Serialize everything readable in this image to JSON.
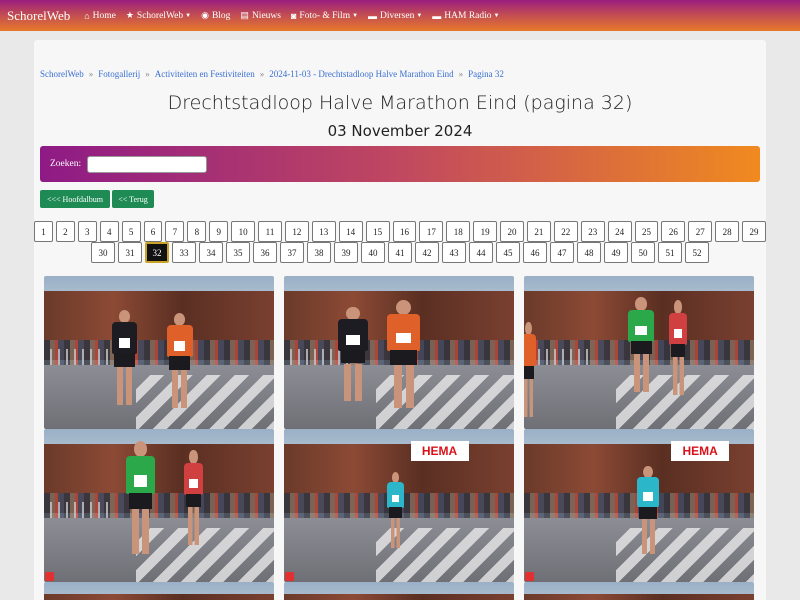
{
  "navbar": {
    "brand": "SchorelWeb",
    "items": [
      {
        "icon": "home-icon",
        "glyph": "⌂",
        "label": "Home",
        "dropdown": false
      },
      {
        "icon": "star-icon",
        "glyph": "★",
        "label": "SchorelWeb",
        "dropdown": true
      },
      {
        "icon": "rss-icon",
        "glyph": "◉",
        "label": "Blog",
        "dropdown": false
      },
      {
        "icon": "newspaper-icon",
        "glyph": "▤",
        "label": "Nieuws",
        "dropdown": false
      },
      {
        "icon": "camera-icon",
        "glyph": "◙",
        "label": "Foto- & Film",
        "dropdown": true
      },
      {
        "icon": "folder-icon",
        "glyph": "▬",
        "label": "Diversen",
        "dropdown": true
      },
      {
        "icon": "folder-icon",
        "glyph": "▬",
        "label": "HAM Radio",
        "dropdown": true
      }
    ]
  },
  "breadcrumb": [
    "SchorelWeb",
    "Fotogallerij",
    "Activiteiten en Festiviteiten",
    "2024-11-03 - Drechtstadloop Halve Marathon Eind",
    "Pagina 32"
  ],
  "page": {
    "title": "Drechtstadloop Halve Marathon Eind (pagina 32)",
    "date": "03 November 2024"
  },
  "search": {
    "label": "Zoeken:",
    "value": "",
    "placeholder": ""
  },
  "buttons": {
    "main_album": "<<< Hoofdalbum",
    "back": "<< Terug"
  },
  "pagination": {
    "current": "32",
    "row1": [
      "1",
      "2",
      "3",
      "4",
      "5",
      "6",
      "7",
      "8",
      "9",
      "10",
      "11",
      "12",
      "13",
      "14",
      "15",
      "16",
      "17",
      "18",
      "19",
      "20",
      "21",
      "22",
      "23",
      "24",
      "25",
      "26",
      "27",
      "28",
      "29"
    ],
    "row2": [
      "30",
      "31",
      "32",
      "33",
      "34",
      "35",
      "36",
      "37",
      "38",
      "39",
      "40",
      "41",
      "42",
      "43",
      "44",
      "45",
      "46",
      "47",
      "48",
      "49",
      "50",
      "51",
      "52"
    ]
  },
  "photo_signs": {
    "store": "HEMA"
  },
  "colors": {
    "navbar_start": "#9a1e7e",
    "navbar_end": "#e8792a",
    "button_green": "#1e8b55",
    "active_page_border": "#c9a227",
    "link": "#3a6fd0"
  }
}
